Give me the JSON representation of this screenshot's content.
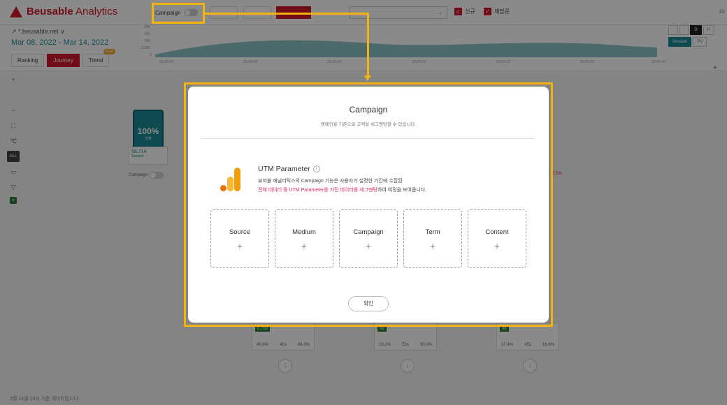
{
  "header": {
    "brand_bold": "Beusable",
    "brand_rest": " Analytics",
    "campaign_toggle_label": "Campaign",
    "checkbox_new": "신규",
    "checkbox_returning": "재방문",
    "user_icon": "person-icon"
  },
  "subheader": {
    "site": "↗ *.beusable.net ∨",
    "date_range": "Mar 08, 2022 - Mar 14, 2022",
    "tabs": [
      "Ranking",
      "Journey",
      "Trend"
    ],
    "trend_badge": "NEW",
    "unit_buttons": [
      "D",
      "H"
    ],
    "metric_buttons": [
      "Session",
      "PV"
    ],
    "chart_y_ticks": [
      "20K",
      "15K",
      "10K",
      "5,000",
      "0"
    ],
    "chart_x_ticks": [
      "22-03-08",
      "22-03-09",
      "22-03-10",
      "22-03-11",
      "22-03-12",
      "22-03-13",
      "22-03-14"
    ]
  },
  "journey": {
    "start_pct": "100%",
    "start_sub": "전체",
    "session_count": "58,714",
    "session_label": "Session",
    "campaign_label": "Campaign",
    "side_pct": "5.5%",
    "cards": [
      {
        "value": "6,789",
        "stats": [
          "40.8%",
          "40s",
          "84.3%"
        ]
      },
      {
        "value": "99",
        "stats": [
          "18.2%",
          "53s",
          "30.3%"
        ]
      },
      {
        "value": "88",
        "stats": [
          "17.4%",
          "45s",
          "16.6%"
        ]
      }
    ]
  },
  "footnote": "3월 14일 16시 기준 데이터입니다.",
  "modal": {
    "title": "Campaign",
    "subtitle": "캠페인을 기준으로 고객을 세그멘팅할 수 있습니다.",
    "utm_title": "UTM Parameter",
    "utm_desc1": "뷰저블 애널리틱스의 Campaign 기능은 사용자가 설정한 기간에 수집된",
    "utm_desc2_highlight": "전체 데이터 중 UTM Parameter를 가진 데이터를 세그멘팅",
    "utm_desc2_rest": "하여 여정을 보여줍니다.",
    "params": [
      "Source",
      "Medium",
      "Campaign",
      "Term",
      "Content"
    ],
    "plus": "+",
    "confirm": "확인"
  },
  "colors": {
    "brand_red": "#d0192f",
    "teal": "#1c8a96",
    "highlight_yellow": "#f2b311",
    "analytics_orange": "#f29d0b"
  }
}
